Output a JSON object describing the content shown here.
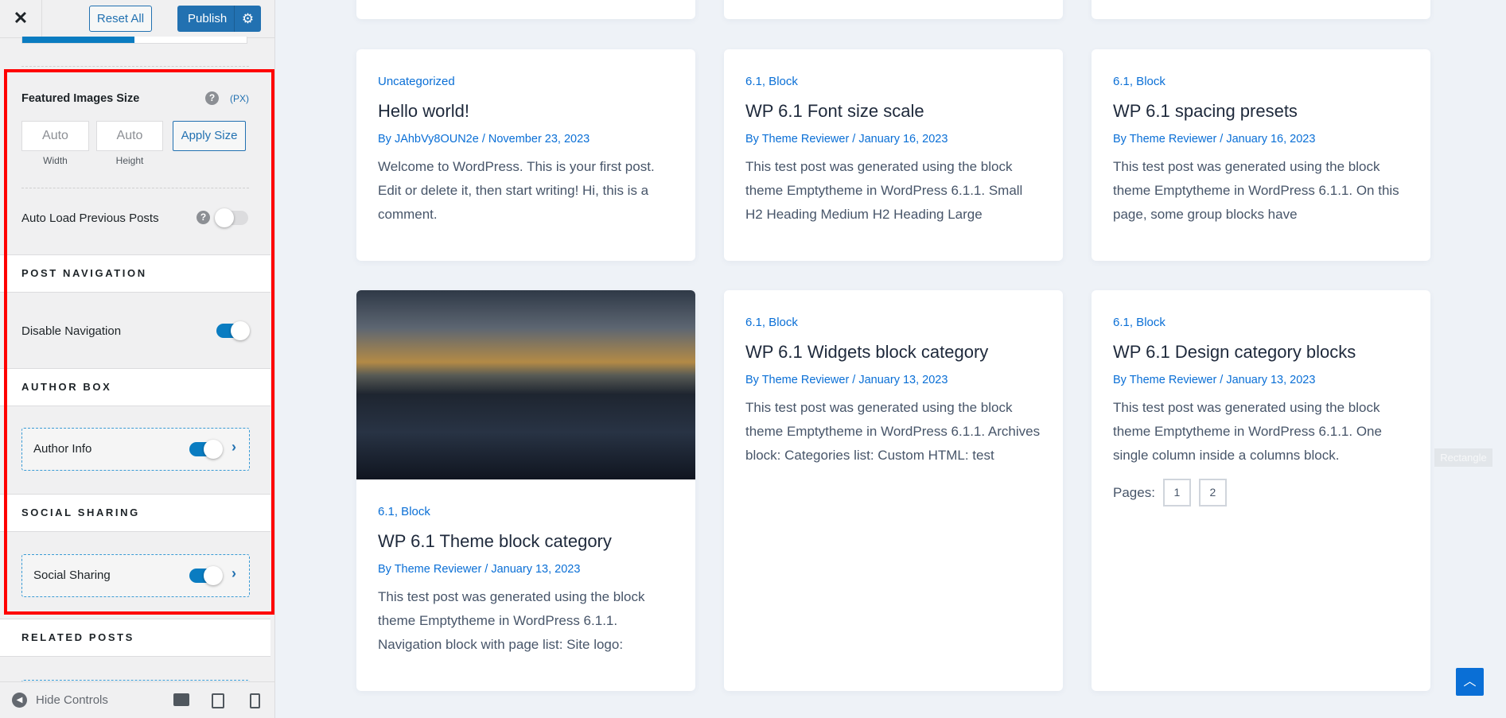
{
  "header": {
    "close_icon": "close-icon",
    "reset_label": "Reset All",
    "publish_label": "Publish",
    "settings_icon": "gear-icon"
  },
  "progress": {
    "fraction": 0.5
  },
  "featured": {
    "label": "Featured Images Size",
    "help": "?",
    "unit": "(PX)",
    "width_value": "Auto",
    "height_value": "Auto",
    "width_label": "Width",
    "height_label": "Height",
    "apply_label": "Apply Size"
  },
  "auto_load": {
    "label": "Auto Load Previous Posts",
    "help": "?",
    "enabled": false
  },
  "post_navigation": {
    "heading": "POST NAVIGATION",
    "disable_label": "Disable Navigation",
    "enabled": true
  },
  "author_box": {
    "heading": "AUTHOR BOX",
    "item_label": "Author Info",
    "enabled": true,
    "chevron": "›"
  },
  "social_sharing": {
    "heading": "SOCIAL SHARING",
    "item_label": "Social Sharing",
    "enabled": true,
    "chevron": "›"
  },
  "related_posts": {
    "heading": "RELATED POSTS"
  },
  "footer": {
    "hide_label": "Hide Controls",
    "icons": [
      "desktop-icon",
      "tablet-icon",
      "mobile-icon"
    ]
  },
  "posts": [
    {
      "category": "Uncategorized",
      "title": "Hello world!",
      "meta": "By JAhbVy8OUN2e / November 23, 2023",
      "excerpt": "Welcome to WordPress. This is your first post. Edit or delete it, then start writing! Hi, this is a comment."
    },
    {
      "category": "6.1, Block",
      "title": "WP 6.1 Font size scale",
      "meta": "By Theme Reviewer / January 16, 2023",
      "excerpt": "This test post was generated using the block theme Emptytheme in WordPress 6.1.1. Small H2 Heading Medium H2 Heading Large"
    },
    {
      "category": "6.1, Block",
      "title": "WP 6.1 spacing presets",
      "meta": "By Theme Reviewer / January 16, 2023",
      "excerpt": "This test post was generated using the block theme Emptytheme in WordPress 6.1.1. On this page, some group blocks have"
    },
    {
      "category": "6.1, Block",
      "title": "WP 6.1 Theme block category",
      "meta": "By Theme Reviewer / January 13, 2023",
      "excerpt": "This test post was generated using the block theme Emptytheme in WordPress 6.1.1. Navigation block with page list: Site logo:"
    },
    {
      "category": "6.1, Block",
      "title": "WP 6.1 Widgets block category",
      "meta": "By Theme Reviewer / January 13, 2023",
      "excerpt": "This test post was generated using the block theme Emptytheme in WordPress 6.1.1. Archives block: Categories list: Custom HTML: test"
    },
    {
      "category": "6.1, Block",
      "title": "WP 6.1 Design category blocks",
      "meta": "By Theme Reviewer / January 13, 2023",
      "excerpt": "This test post was generated using the block theme Emptytheme in WordPress 6.1.1. One single column inside a columns block.",
      "pages_label": "Pages:",
      "pages": [
        "1",
        "2"
      ]
    }
  ],
  "overlay": {
    "rectangle_label": "Rectangle"
  },
  "scroll_top": {
    "icon": "chevron-up-icon"
  },
  "colors": {
    "accent": "#2271b1",
    "link": "#0a6fd6",
    "highlight": "#ff0000"
  }
}
